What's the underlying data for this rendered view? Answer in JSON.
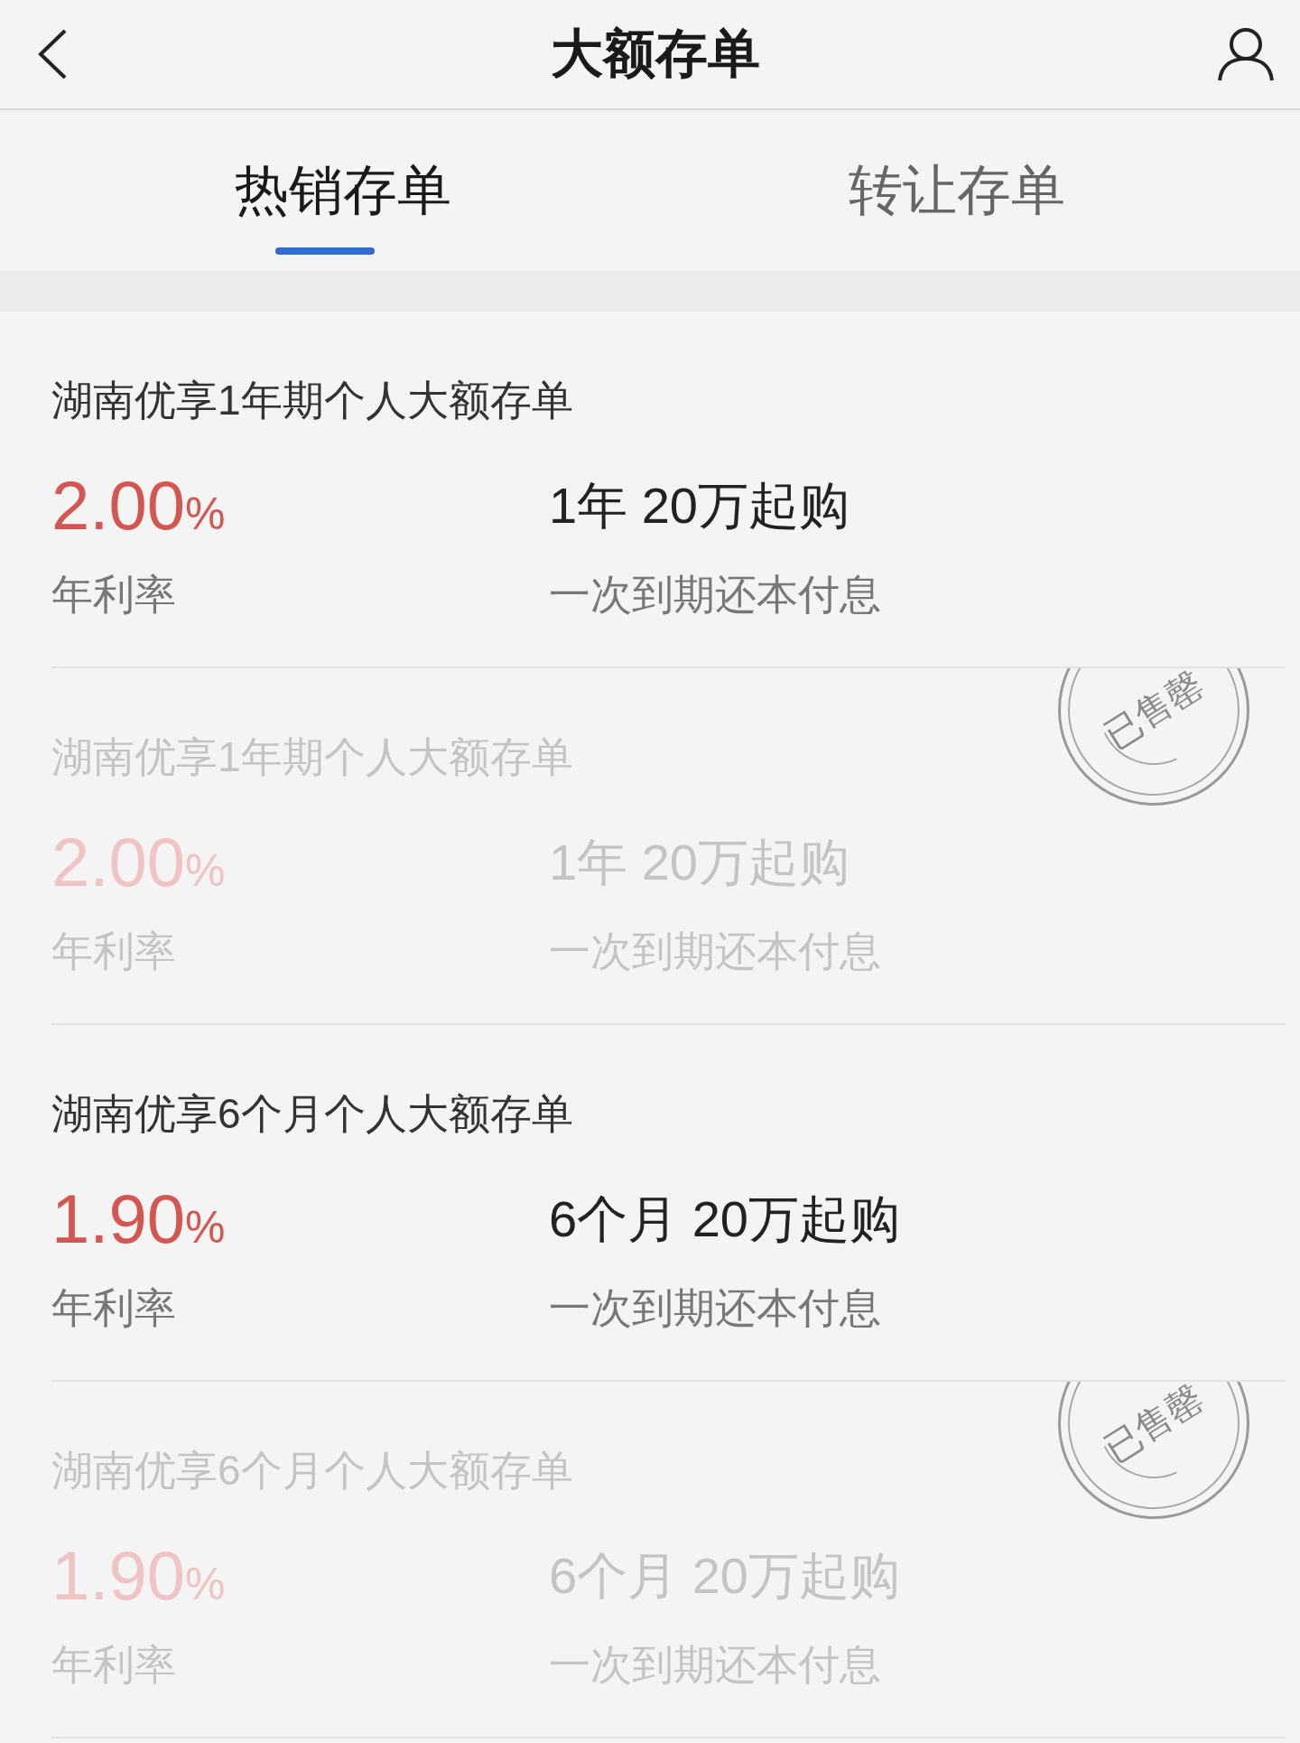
{
  "header": {
    "title": "大额存单"
  },
  "tabs": [
    {
      "label": "热销存单",
      "selected": true
    },
    {
      "label": "转让存单",
      "selected": false
    }
  ],
  "products": [
    {
      "name": "湖南优享1年期个人大额存单",
      "rate": "2.00",
      "rate_unit": "%",
      "rate_label": "年利率",
      "terms": "1年 20万起购",
      "payout": "一次到期还本付息",
      "sold_out": false
    },
    {
      "name": "湖南优享1年期个人大额存单",
      "rate": "2.00",
      "rate_unit": "%",
      "rate_label": "年利率",
      "terms": "1年 20万起购",
      "payout": "一次到期还本付息",
      "sold_out": true,
      "stamp": "已售罄"
    },
    {
      "name": "湖南优享6个月个人大额存单",
      "rate": "1.90",
      "rate_unit": "%",
      "rate_label": "年利率",
      "terms": "6个月 20万起购",
      "payout": "一次到期还本付息",
      "sold_out": false
    },
    {
      "name": "湖南优享6个月个人大额存单",
      "rate": "1.90",
      "rate_unit": "%",
      "rate_label": "年利率",
      "terms": "6个月 20万起购",
      "payout": "一次到期还本付息",
      "sold_out": true,
      "stamp": "已售罄"
    }
  ]
}
